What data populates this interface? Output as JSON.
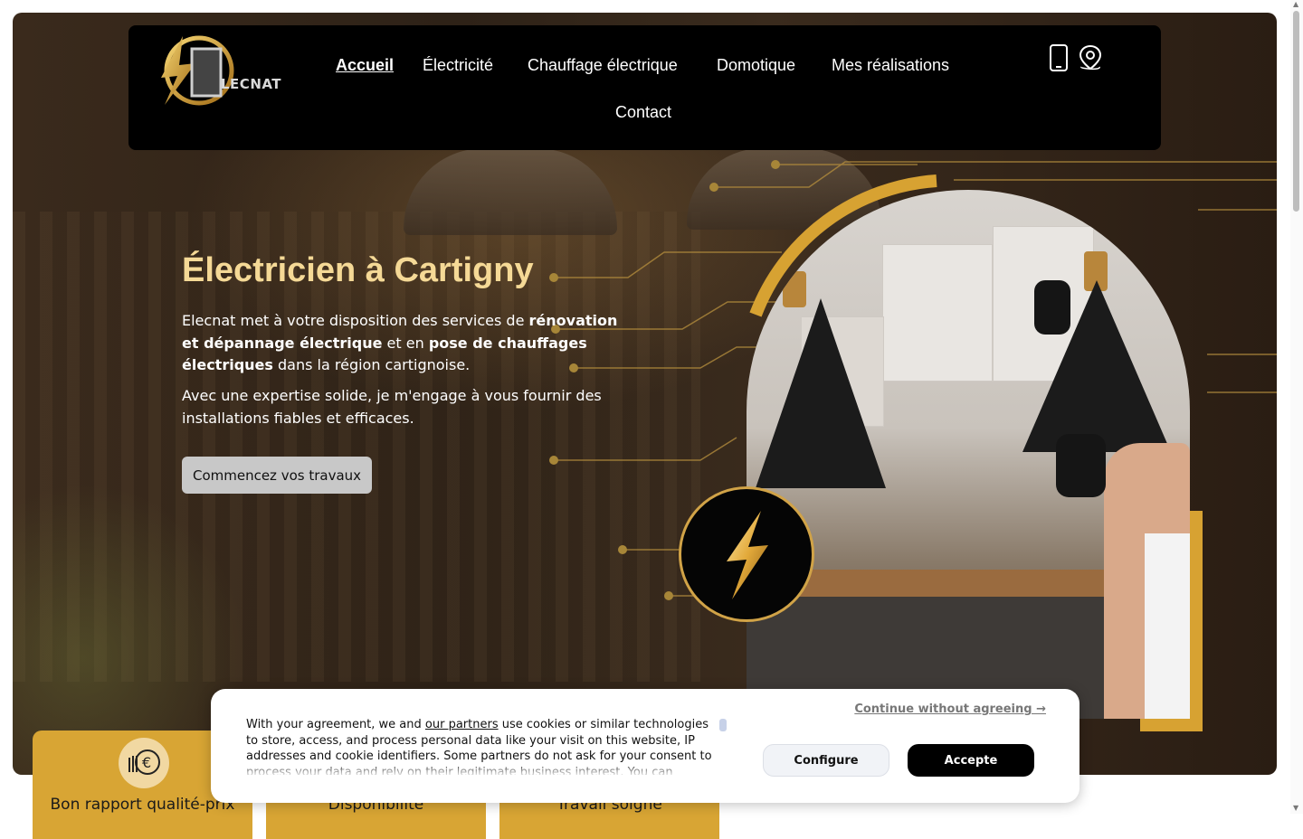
{
  "brand": {
    "logo_letter": "E",
    "logo_word": "LECNAT"
  },
  "nav": {
    "items": [
      {
        "label": "Accueil",
        "active": true
      },
      {
        "label": "Électricité"
      },
      {
        "label": "Chauffage électrique"
      },
      {
        "label": "Domotique"
      },
      {
        "label": "Mes réalisations"
      },
      {
        "label": "Contact"
      }
    ]
  },
  "header_icons": [
    "phone-icon",
    "location-pin-icon"
  ],
  "hero": {
    "title": "Électricien à Cartigny",
    "p1_a": "Elecnat met à votre disposition des services de ",
    "p1_b": "rénovation et dépannage électrique",
    "p1_c": " et en ",
    "p1_d": "pose de chauffages électriques",
    "p1_e": " dans la région cartignoise.",
    "p2": "Avec une expertise solide, je m'engage à vous fournir des installations fiables et efficaces.",
    "cta": "Commencez vos travaux"
  },
  "features": [
    {
      "label": "Bon rapport qualité-prix",
      "icon": "euro-coins-icon"
    },
    {
      "label": "Disponibilité"
    },
    {
      "label": "Travail soigné"
    }
  ],
  "cookie": {
    "text_before": "With your agreement, we and ",
    "partners_link": "our partners",
    "text_after": " use cookies or similar technologies to store, access, and process personal data like your visit on this website, IP addresses and cookie identifiers. Some partners do not ask for your consent to process your data and rely on their legitimate business interest. You can",
    "continue": "Continue without agreeing →",
    "configure": "Configure",
    "accept": "Accepte"
  },
  "colors": {
    "gold": "#d8a534",
    "title": "#f5d996",
    "header_bg": "#000000"
  }
}
